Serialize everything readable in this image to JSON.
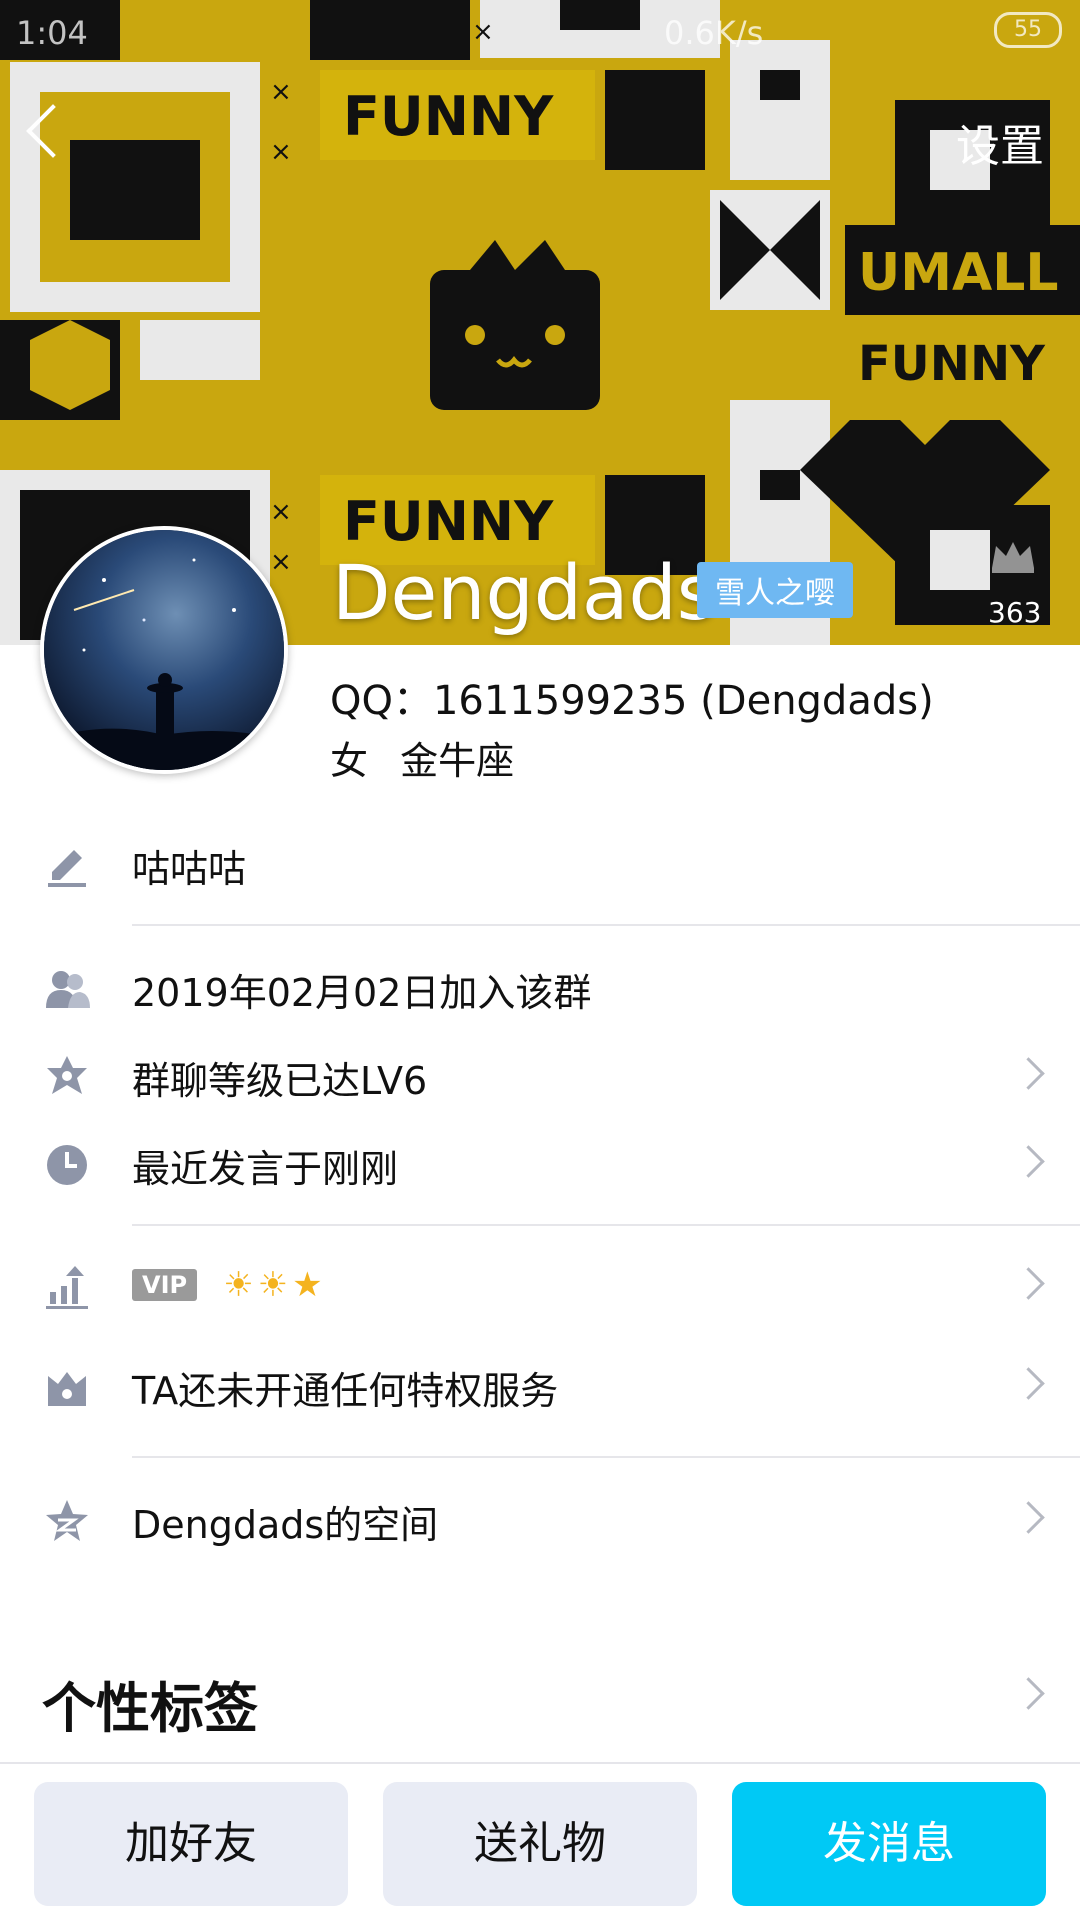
{
  "status_bar": {
    "time": "1:04",
    "speed": "0.6K/s",
    "battery": "55"
  },
  "header": {
    "settings_label": "设置"
  },
  "cover": {
    "words": [
      "FUNNY",
      "UMALL",
      "FUNNY",
      "FUNNY"
    ],
    "colors": {
      "yellow": "#c9a70f",
      "dark": "#111111",
      "light": "#e9e9e9"
    }
  },
  "profile": {
    "name": "Dengdads",
    "group_nickname_badge": "雪人之嘤",
    "level_count": "363",
    "qq_line": "QQ：1611599235 (Dengdads)",
    "gender": "女",
    "zodiac": "金牛座"
  },
  "info_rows": {
    "signature": "咕咕咕",
    "joined": "2019年02月02日加入该群",
    "group_level": "群聊等级已达LV6",
    "last_speak": "最近发言于刚刚",
    "vip_label": "VIP",
    "vip_icons": "☀☀★",
    "privilege": "TA还未开通任何特权服务",
    "space": "Dengdads的空间"
  },
  "tags_section": {
    "title": "个性标签"
  },
  "bottom_buttons": {
    "add_friend": "加好友",
    "send_gift": "送礼物",
    "send_message": "发消息"
  },
  "colors": {
    "accent": "#00c9f5",
    "badge": "#6fb8f2",
    "icon_gray": "#8e95a8"
  }
}
